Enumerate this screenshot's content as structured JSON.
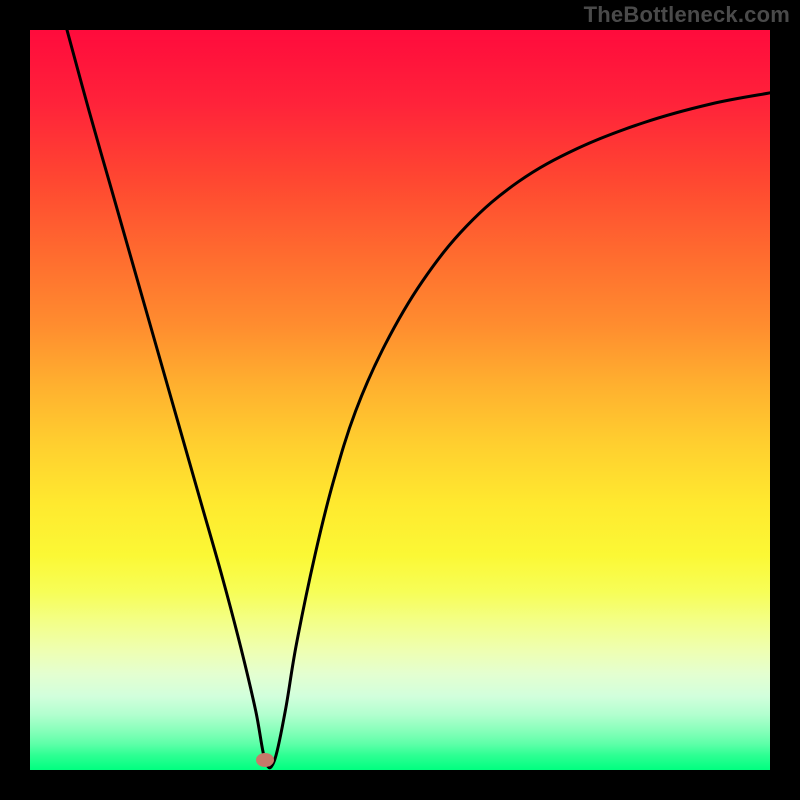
{
  "watermark": "TheBottleneck.com",
  "chart_data": {
    "type": "line",
    "title": "",
    "xlabel": "",
    "ylabel": "",
    "xlim": [
      0,
      100
    ],
    "ylim": [
      0,
      100
    ],
    "grid": false,
    "legend": false,
    "marker": {
      "cx": 31.8,
      "cy": 1.4,
      "color": "#c67a6a"
    },
    "background_gradient_stops": [
      {
        "pct": 0,
        "color": "#ff0b3c"
      },
      {
        "pct": 50,
        "color": "#ffb02f"
      },
      {
        "pct": 75,
        "color": "#f7fe58"
      },
      {
        "pct": 100,
        "color": "#00ff80"
      }
    ],
    "series": [
      {
        "name": "bottleneck-curve",
        "x": [
          5.0,
          8.0,
          11.0,
          14.0,
          17.0,
          20.0,
          23.0,
          26.0,
          28.5,
          30.5,
          31.8,
          33.0,
          34.5,
          36.0,
          38.5,
          41.0,
          44.0,
          48.0,
          53.0,
          59.0,
          66.0,
          74.0,
          83.0,
          92.0,
          100.0
        ],
        "y": [
          100.0,
          89.0,
          78.5,
          68.0,
          57.5,
          47.0,
          36.5,
          26.0,
          16.5,
          8.0,
          1.2,
          1.2,
          8.0,
          17.0,
          29.0,
          39.0,
          48.5,
          57.5,
          66.0,
          73.5,
          79.5,
          84.0,
          87.5,
          90.0,
          91.5
        ]
      }
    ]
  }
}
